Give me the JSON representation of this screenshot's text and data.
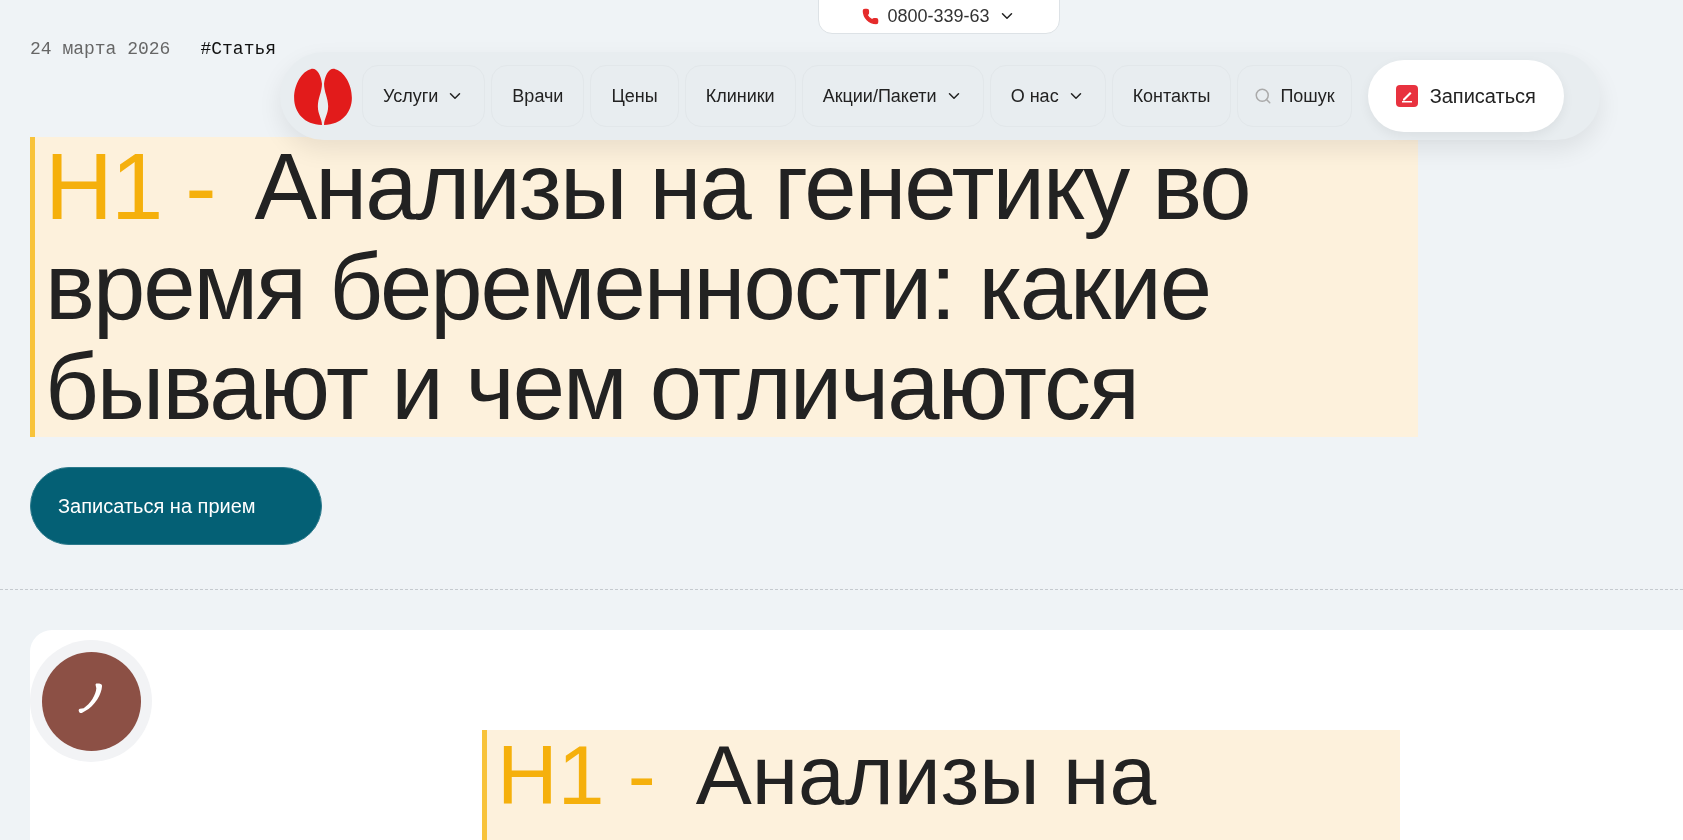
{
  "phone": {
    "number": "0800-339-63"
  },
  "meta": {
    "date": "24 марта 2026",
    "tag": "#Статья"
  },
  "nav": {
    "items": [
      {
        "label": "Услуги",
        "dropdown": true
      },
      {
        "label": "Врачи",
        "dropdown": false
      },
      {
        "label": "Цены",
        "dropdown": false
      },
      {
        "label": "Клиники",
        "dropdown": false
      },
      {
        "label": "Акции/Пакети",
        "dropdown": true
      },
      {
        "label": "О нас",
        "dropdown": true
      },
      {
        "label": "Контакты",
        "dropdown": false
      }
    ],
    "search": "Пошук",
    "cta": "Записаться"
  },
  "hero": {
    "prefix": "H1 -",
    "title": "Анализы на генетику во время беременности: какие бывают и чем отличаются",
    "button": "Записаться на прием"
  },
  "card": {
    "prefix": "H1 -",
    "title": "Анализы на"
  }
}
